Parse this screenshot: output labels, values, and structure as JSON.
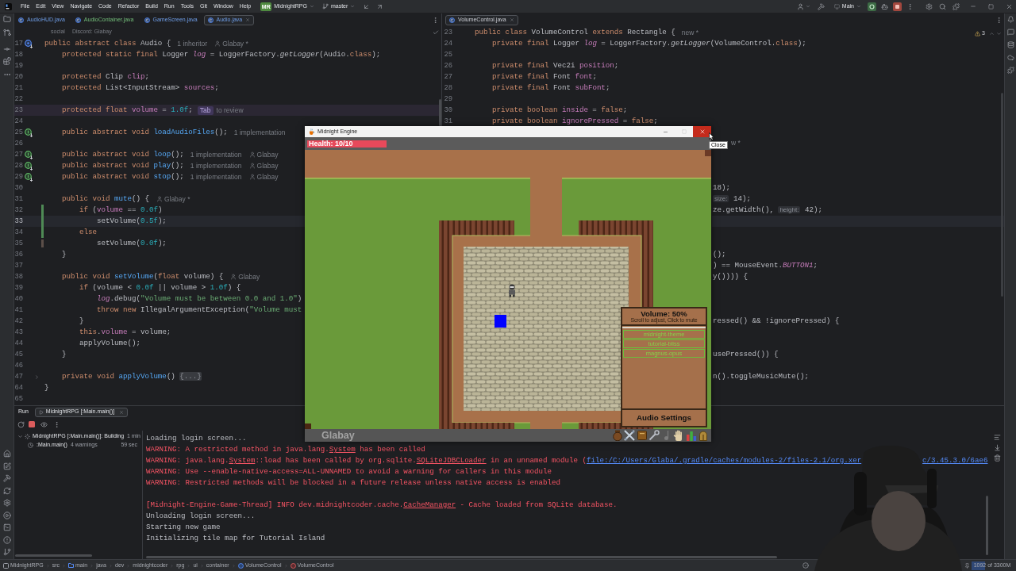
{
  "menu_bar": {
    "menus": [
      "File",
      "Edit",
      "View",
      "Navigate",
      "Code",
      "Refactor",
      "Build",
      "Run",
      "Tools",
      "Git",
      "Window",
      "Help"
    ],
    "project_badge": "MR",
    "project": "MidnightRPG",
    "branch": "master",
    "run_config": "Main"
  },
  "left_editor": {
    "tabs": [
      {
        "label": "AudioHUD.java",
        "kind": "modified",
        "selected": false
      },
      {
        "label": "AudioContainer.java",
        "kind": "added",
        "selected": false
      },
      {
        "label": "GameScreen.java",
        "kind": "modified",
        "selected": false
      },
      {
        "label": "Audio.java",
        "kind": "modified",
        "selected": true
      }
    ],
    "breadcrumb": [
      "social",
      "Discord: Glabay"
    ],
    "lines": [
      {
        "number": "17",
        "code": [
          {
            "kind": "kw",
            "text": "public abstract class "
          },
          {
            "kind": "plain",
            "text": "Audio {"
          }
        ],
        "gutter": {
          "kind": "inheritors"
        },
        "hint": "1 inheritor",
        "author": "Glabay *",
        "current": false
      },
      {
        "number": "18",
        "code": [
          {
            "kind": "kw",
            "text": "    protected static final "
          },
          {
            "kind": "plain",
            "text": "Logger "
          },
          {
            "kind": "field_it",
            "text": "log"
          },
          {
            "kind": "plain",
            "text": " = LoggerFactory."
          },
          {
            "kind": "it",
            "text": "getLogger"
          },
          {
            "kind": "plain",
            "text": "(Audio."
          },
          {
            "kind": "kw",
            "text": "class"
          },
          {
            "kind": "plain",
            "text": ");"
          }
        ],
        "current": false
      },
      {
        "number": "19",
        "current": false
      },
      {
        "number": "20",
        "code": [
          {
            "kind": "kw",
            "text": "    protected "
          },
          {
            "kind": "plain",
            "text": "Clip "
          },
          {
            "kind": "field",
            "text": "clip"
          },
          {
            "kind": "plain",
            "text": ";"
          }
        ],
        "current": false
      },
      {
        "number": "21",
        "code": [
          {
            "kind": "kw",
            "text": "    protected "
          },
          {
            "kind": "plain",
            "text": "List<InputStream> "
          },
          {
            "kind": "field",
            "text": "sources"
          },
          {
            "kind": "plain",
            "text": ";"
          }
        ],
        "current": false
      },
      {
        "number": "22",
        "current": false
      },
      {
        "number": "23",
        "code": [
          {
            "kind": "kw",
            "text": "    protected float "
          },
          {
            "kind": "field",
            "text": "volume"
          },
          {
            "kind": "plain",
            "text": " = "
          },
          {
            "kind": "num",
            "text": "1.0f"
          },
          {
            "kind": "plain",
            "text": ";"
          }
        ],
        "suggestion": {
          "key": "Tab",
          "text": "to review"
        },
        "current": false
      },
      {
        "number": "24",
        "current": false
      },
      {
        "number": "25",
        "code": [
          {
            "kind": "kw",
            "text": "    public abstract void "
          },
          {
            "kind": "method",
            "text": "loadAudioFiles"
          },
          {
            "kind": "plain",
            "text": "();"
          }
        ],
        "gutter": {
          "kind": "implemented"
        },
        "hint": "1 implementation",
        "current": false
      },
      {
        "number": "26",
        "current": false
      },
      {
        "number": "27",
        "code": [
          {
            "kind": "kw",
            "text": "    public abstract void "
          },
          {
            "kind": "method",
            "text": "loop"
          },
          {
            "kind": "plain",
            "text": "();"
          }
        ],
        "gutter": {
          "kind": "implemented"
        },
        "hint": "1 implementation",
        "author": "Glabay",
        "current": false
      },
      {
        "number": "28",
        "code": [
          {
            "kind": "kw",
            "text": "    public abstract void "
          },
          {
            "kind": "method",
            "text": "play"
          },
          {
            "kind": "plain",
            "text": "();"
          }
        ],
        "gutter": {
          "kind": "implemented"
        },
        "hint": "1 implementation",
        "author": "Glabay",
        "current": false
      },
      {
        "number": "29",
        "code": [
          {
            "kind": "kw",
            "text": "    public abstract void "
          },
          {
            "kind": "method",
            "text": "stop"
          },
          {
            "kind": "plain",
            "text": "();"
          }
        ],
        "gutter": {
          "kind": "implemented"
        },
        "hint": "1 implementation",
        "author": "Glabay",
        "current": false
      },
      {
        "number": "30",
        "current": false
      },
      {
        "number": "31",
        "code": [
          {
            "kind": "kw",
            "text": "    public void "
          },
          {
            "kind": "method",
            "text": "mute"
          },
          {
            "kind": "plain",
            "text": "() {"
          }
        ],
        "author": "Glabay *",
        "current": false
      },
      {
        "number": "32",
        "code": [
          {
            "kind": "kw",
            "text": "        if "
          },
          {
            "kind": "plain",
            "text": "("
          },
          {
            "kind": "field",
            "text": "volume"
          },
          {
            "kind": "plain",
            "text": " == "
          },
          {
            "kind": "num",
            "text": "0.0f"
          },
          {
            "kind": "plain",
            "text": ")"
          }
        ],
        "change": {
          "kind": "modified"
        },
        "current": false
      },
      {
        "number": "33",
        "code": [
          {
            "kind": "plain",
            "text": "            setVolume("
          },
          {
            "kind": "num",
            "text": "0.5f"
          },
          {
            "kind": "plain",
            "text": ");"
          }
        ],
        "change": {
          "kind": "modified"
        },
        "current": true
      },
      {
        "number": "34",
        "code": [
          {
            "kind": "kw",
            "text": "        else"
          }
        ],
        "change": {
          "kind": "modified"
        },
        "current": false
      },
      {
        "number": "35",
        "code": [
          {
            "kind": "plain",
            "text": "            setVolume("
          },
          {
            "kind": "num",
            "text": "0.0f"
          },
          {
            "kind": "plain",
            "text": ");"
          }
        ],
        "change": {
          "kind": "deleted"
        },
        "current": false
      },
      {
        "number": "36",
        "code": [
          {
            "kind": "plain",
            "text": "    }"
          }
        ],
        "current": false
      },
      {
        "number": "37",
        "current": false
      },
      {
        "number": "38",
        "code": [
          {
            "kind": "kw",
            "text": "    public void "
          },
          {
            "kind": "method",
            "text": "setVolume"
          },
          {
            "kind": "plain",
            "text": "("
          },
          {
            "kind": "kw",
            "text": "float "
          },
          {
            "kind": "plain",
            "text": "volume) {"
          }
        ],
        "author": "Glabay",
        "current": false
      },
      {
        "number": "39",
        "code": [
          {
            "kind": "kw",
            "text": "        if "
          },
          {
            "kind": "plain",
            "text": "(volume < "
          },
          {
            "kind": "num",
            "text": "0.0f"
          },
          {
            "kind": "plain",
            "text": " || volume > "
          },
          {
            "kind": "num",
            "text": "1.0f"
          },
          {
            "kind": "plain",
            "text": ") {"
          }
        ],
        "current": false
      },
      {
        "number": "40",
        "code": [
          {
            "kind": "field_it",
            "text": "            log"
          },
          {
            "kind": "plain",
            "text": ".debug("
          },
          {
            "kind": "str",
            "text": "\"Volume must be between 0.0 and 1.0\""
          },
          {
            "kind": "plain",
            "text": ")"
          }
        ],
        "current": false
      },
      {
        "number": "41",
        "code": [
          {
            "kind": "kw",
            "text": "            throw new "
          },
          {
            "kind": "plain",
            "text": "IllegalArgumentException("
          },
          {
            "kind": "str",
            "text": "\"Volume must"
          }
        ],
        "current": false
      },
      {
        "number": "42",
        "code": [
          {
            "kind": "plain",
            "text": "        }"
          }
        ],
        "current": false
      },
      {
        "number": "43",
        "code": [
          {
            "kind": "kw",
            "text": "        this"
          },
          {
            "kind": "plain",
            "text": "."
          },
          {
            "kind": "field",
            "text": "volume"
          },
          {
            "kind": "plain",
            "text": " = volume;"
          }
        ],
        "current": false
      },
      {
        "number": "44",
        "code": [
          {
            "kind": "plain",
            "text": "        applyVolume();"
          }
        ],
        "current": false
      },
      {
        "number": "45",
        "code": [
          {
            "kind": "plain",
            "text": "    }"
          }
        ],
        "current": false
      },
      {
        "number": "46",
        "current": false
      },
      {
        "number": "47",
        "code": [
          {
            "kind": "kw",
            "text": "    private void "
          },
          {
            "kind": "method",
            "text": "applyVolume"
          },
          {
            "kind": "plain",
            "text": "() "
          },
          {
            "kind": "fold",
            "text": "{...}"
          }
        ],
        "gutter": {
          "kind": "folded"
        },
        "current": false
      },
      {
        "number": "64",
        "code": [
          {
            "kind": "plain",
            "text": "}"
          }
        ],
        "current": false
      },
      {
        "number": "65",
        "current": false
      }
    ]
  },
  "right_editor": {
    "tabs": [
      {
        "label": "VolumeControl.java",
        "selected": true
      }
    ],
    "problems": "3",
    "lines": [
      {
        "number": "23",
        "code": [
          {
            "kind": "kw",
            "text": "public class "
          },
          {
            "kind": "plain",
            "text": "VolumeControl "
          },
          {
            "kind": "kw",
            "text": "extends "
          },
          {
            "kind": "plain",
            "text": "Rectangle {"
          }
        ],
        "hint": "new *"
      },
      {
        "number": "24",
        "code": [
          {
            "kind": "kw",
            "text": "    private final "
          },
          {
            "kind": "plain",
            "text": "Logger "
          },
          {
            "kind": "field_it",
            "text": "log"
          },
          {
            "kind": "plain",
            "text": " = LoggerFactory."
          },
          {
            "kind": "it",
            "text": "getLogger"
          },
          {
            "kind": "plain",
            "text": "(VolumeControl."
          },
          {
            "kind": "kw",
            "text": "class"
          },
          {
            "kind": "plain",
            "text": ");"
          }
        ]
      },
      {
        "number": "25"
      },
      {
        "number": "26",
        "code": [
          {
            "kind": "kw",
            "text": "    private final "
          },
          {
            "kind": "plain",
            "text": "Vec2i "
          },
          {
            "kind": "field",
            "text": "position"
          },
          {
            "kind": "plain",
            "text": ";"
          }
        ]
      },
      {
        "number": "27",
        "code": [
          {
            "kind": "kw",
            "text": "    private final "
          },
          {
            "kind": "plain",
            "text": "Font "
          },
          {
            "kind": "field",
            "text": "font"
          },
          {
            "kind": "plain",
            "text": ";"
          }
        ]
      },
      {
        "number": "28",
        "code": [
          {
            "kind": "kw",
            "text": "    private final "
          },
          {
            "kind": "plain",
            "text": "Font "
          },
          {
            "kind": "field",
            "text": "subFont"
          },
          {
            "kind": "plain",
            "text": ";"
          }
        ]
      },
      {
        "number": "29"
      },
      {
        "number": "30",
        "code": [
          {
            "kind": "kw",
            "text": "    private boolean "
          },
          {
            "kind": "field",
            "text": "inside"
          },
          {
            "kind": "plain",
            "text": " = "
          },
          {
            "kind": "kw",
            "text": "false"
          },
          {
            "kind": "plain",
            "text": ";"
          }
        ]
      },
      {
        "number": "31",
        "code": [
          {
            "kind": "kw",
            "text": "    private boolean "
          },
          {
            "kind": "field",
            "text": "ignorePressed"
          },
          {
            "kind": "plain",
            "text": " = "
          },
          {
            "kind": "kw",
            "text": "false"
          },
          {
            "kind": "plain",
            "text": ";"
          }
        ]
      }
    ],
    "fragments": [
      {
        "code": [
          {
            "kind": "hint",
            "text": "w *"
          }
        ],
        "current": false
      },
      {
        "code": [
          {
            "kind": "plain",
            "text": "18);"
          }
        ],
        "current": false
      },
      {
        "code": [
          {
            "kind": "param",
            "text": "size:"
          },
          {
            "kind": "plain",
            "text": " 14);"
          }
        ],
        "current": false
      },
      {
        "code": [
          {
            "kind": "plain",
            "text": "ze.getWidth(), "
          },
          {
            "kind": "param",
            "text": "height:"
          },
          {
            "kind": "plain",
            "text": " 42);"
          }
        ],
        "current": false
      },
      {
        "current": true
      },
      {
        "code": [
          {
            "kind": "plain",
            "text": "();"
          }
        ],
        "current": false
      },
      {
        "code": [
          {
            "kind": "plain",
            "text": ") == MouseEvent."
          },
          {
            "kind": "const",
            "text": "BUTTON1"
          },
          {
            "kind": "plain",
            "text": ";"
          }
        ],
        "current": false
      },
      {
        "code": [
          {
            "kind": "plain",
            "text": "y()))) {"
          }
        ],
        "current": false
      },
      {
        "code": [
          {
            "kind": "plain",
            "text": "ressed() && !ignorePressed) {"
          }
        ],
        "current": false
      },
      {
        "code": [
          {
            "kind": "plain",
            "text": "usePressed()) {"
          }
        ],
        "current": false
      },
      {
        "code": [
          {
            "kind": "plain",
            "text": "n().toggleMusicMute();"
          }
        ],
        "current": false
      }
    ]
  },
  "game_window": {
    "title": "Midnight Engine",
    "tooltip": "Close",
    "health": {
      "text": "Health: 10/10",
      "level": 1
    },
    "volume_panel": {
      "title": "Volume: 50%",
      "hint": "Scroll to adjust, Click to mute",
      "tracks": [
        "midnight-theme",
        "tutorial-bliss",
        "magnus-opus"
      ],
      "button": "Audio Settings"
    },
    "player_name": "Glabay"
  },
  "run_panel": {
    "title": "Run",
    "tabs": [
      {
        "label": "MidnightRPG [:Main.main()]",
        "selected": true
      }
    ],
    "tree": [
      {
        "label": "MidnightRPG [:Main.main()]: Building",
        "time": "1 min",
        "expanded": true,
        "children": [
          {
            "label": ":Main.main()",
            "note": "4 warnings",
            "time": "59 sec"
          }
        ]
      }
    ],
    "console": [
      [
        [
          {
            "kind": "out",
            "text": "Loading login screen..."
          }
        ],
        [
          {
            "kind": "err",
            "text": "WARNING: A restricted method in java.lang."
          },
          {
            "kind": "ref",
            "text": "System"
          },
          {
            "kind": "err",
            "text": " has been called"
          }
        ],
        [
          {
            "kind": "err",
            "text": "WARNING: java.lang."
          },
          {
            "kind": "ref",
            "text": "System"
          },
          {
            "kind": "err",
            "text": "::load has been called by org.sqlite."
          },
          {
            "kind": "ref",
            "text": "SQLiteJDBCLoader"
          },
          {
            "kind": "err",
            "text": " in an unnamed module ("
          },
          {
            "kind": "link",
            "text": "file:/C:/Users/Glaba/.gradle/caches/modules-2/files-2.1/org.xer"
          },
          {
            "kind": "link",
            "text": "c/3.45.3.0/6ae6"
          }
        ],
        [
          {
            "kind": "err",
            "text": "WARNING: Use --enable-native-access=ALL-UNNAMED to avoid a warning for callers in this module"
          }
        ],
        [
          {
            "kind": "err",
            "text": "WARNING: Restricted methods will be blocked in a future release unless native access is enabled"
          }
        ]
      ],
      [
        [
          {
            "kind": "err",
            "text": "[Midnight-Engine-Game-Thread] INFO dev.midnightcoder.cache."
          },
          {
            "kind": "ref",
            "text": "CacheManager"
          },
          {
            "kind": "err",
            "text": " - Cache loaded from SQLite database."
          }
        ],
        [
          {
            "kind": "out",
            "text": "Unloading login screen..."
          }
        ],
        [
          {
            "kind": "out",
            "text": "Starting new game"
          }
        ],
        [
          {
            "kind": "out",
            "text": "Initializing tile map for Tutorial Island"
          }
        ]
      ]
    ]
  },
  "status_bar": {
    "breadcrumb": [
      {
        "label": "MidnightRPG",
        "kind": "module"
      },
      {
        "label": "src",
        "kind": "plain"
      },
      {
        "label": "main",
        "kind": "folder"
      },
      {
        "label": "java",
        "kind": "plain"
      },
      {
        "label": "dev",
        "kind": "plain"
      },
      {
        "label": "midnightcoder",
        "kind": "plain"
      },
      {
        "label": "rpg",
        "kind": "plain"
      },
      {
        "label": "ui",
        "kind": "plain"
      },
      {
        "label": "container",
        "kind": "plain"
      },
      {
        "label": "VolumeControl",
        "kind": "class"
      },
      {
        "label": "VolumeControl",
        "kind": "method"
      }
    ],
    "memory": {
      "text": "1092 of 3300M",
      "level": 0.33
    }
  }
}
